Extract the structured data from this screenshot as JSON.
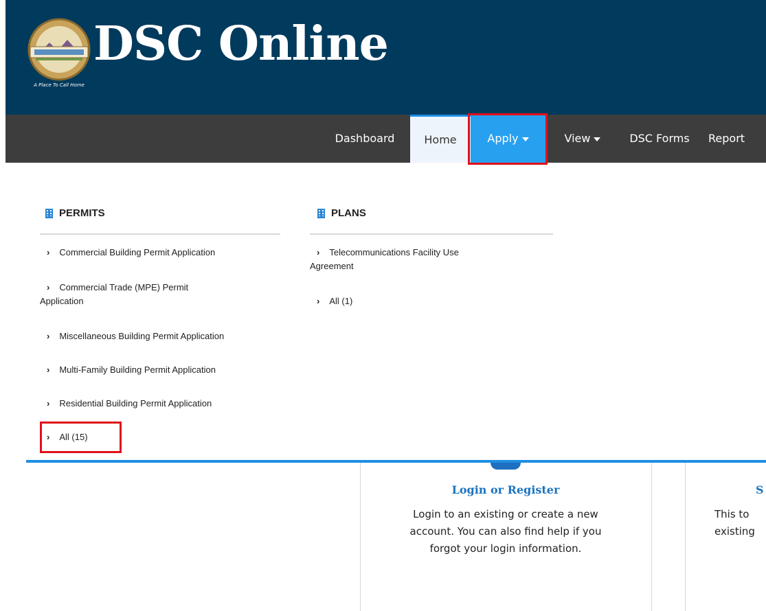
{
  "header": {
    "brand": "DSC Online",
    "logo_tagline": "A Place To Call Home"
  },
  "nav": {
    "items": [
      {
        "label": "Dashboard"
      },
      {
        "label": "Home"
      },
      {
        "label": "Apply"
      },
      {
        "label": "View"
      },
      {
        "label": "DSC Forms"
      },
      {
        "label": "Report"
      }
    ],
    "active": "Home",
    "open_menu": "Apply"
  },
  "dropdown": {
    "permits": {
      "title": "PERMITS",
      "links": [
        "Commercial Building Permit Application",
        "Commercial Trade (MPE) Permit",
        "Application",
        "Miscellaneous Building Permit Application",
        "Multi-Family Building Permit Application",
        "Residential Building Permit Application",
        "All (15)"
      ]
    },
    "plans": {
      "title": "PLANS",
      "links": [
        "Telecommunications Facility Use",
        "Agreement",
        "All (1)"
      ]
    }
  },
  "cards": {
    "login": {
      "title": "Login or Register",
      "lines": [
        "Login to an existing or create a new",
        "account. You can also find help if you",
        "forgot your login information."
      ]
    },
    "second": {
      "title_fragment": "S",
      "lines": [
        "This to",
        "existing"
      ]
    }
  },
  "colors": {
    "header_bg": "#003a5d",
    "nav_bg": "#3d3d3d",
    "apply_bg": "#28a0f0",
    "highlight": "#e0101a",
    "link_blue": "#1a73c0"
  }
}
